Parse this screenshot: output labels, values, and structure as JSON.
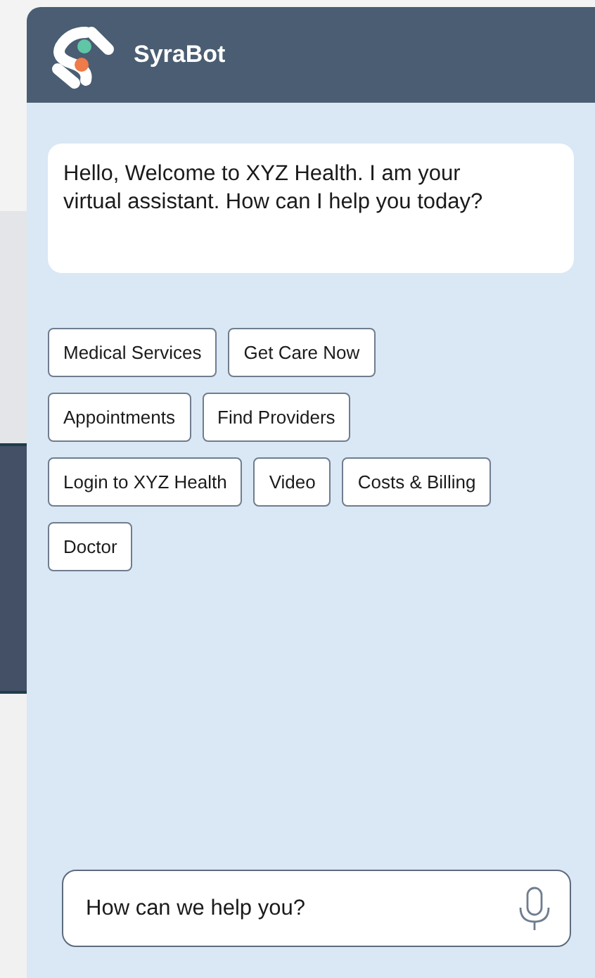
{
  "header": {
    "title": "SyraBot"
  },
  "message": "Hello, Welcome to XYZ Health. I am your virtual assistant. How can I help you today?",
  "options": [
    "Medical Services",
    "Get Care Now",
    "Appointments",
    "Find Providers",
    "Login to XYZ Health",
    "Video",
    "Costs & Billing",
    "Doctor"
  ],
  "input": {
    "placeholder": "How can we help you?"
  }
}
